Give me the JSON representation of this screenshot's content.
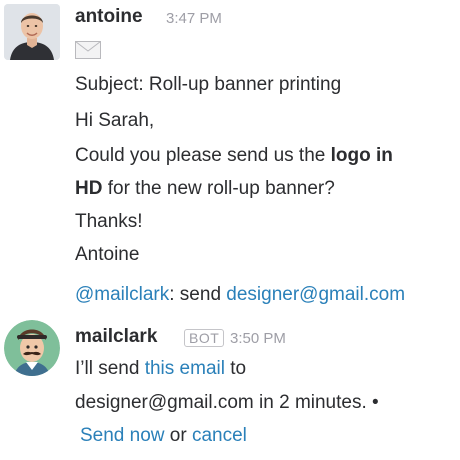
{
  "messages": [
    {
      "author": "antoine",
      "time": "3:47 PM",
      "avatar_icon": "person-photo",
      "email": {
        "icon": "envelope-icon",
        "subject": "Subject: Roll-up banner printing",
        "greeting": "Hi Sarah,",
        "body_line1_pre": "Could you please send us the ",
        "body_line1_bold": "logo in",
        "body_line2_bold": "HD",
        "body_line2_post": " for the new roll-up banner?",
        "thanks": "Thanks!",
        "signature": "Antoine"
      },
      "command": {
        "mention": "@mailclark",
        "text": ": send ",
        "address": "designer@gmail.com"
      }
    },
    {
      "author": "mailclark",
      "badge": "BOT",
      "time": "3:50 PM",
      "avatar_icon": "mailclark-bot-avatar",
      "line1_pre": "I’ll send ",
      "line1_link": "this email",
      "line1_post": " to",
      "line2": "designer@gmail.com in 2 minutes. •",
      "send_now": "Send now",
      "or": " or ",
      "cancel": "cancel"
    }
  ],
  "colors": {
    "text": "#2c2d30",
    "muted": "#9e9ea6",
    "link": "#2a80b9"
  }
}
